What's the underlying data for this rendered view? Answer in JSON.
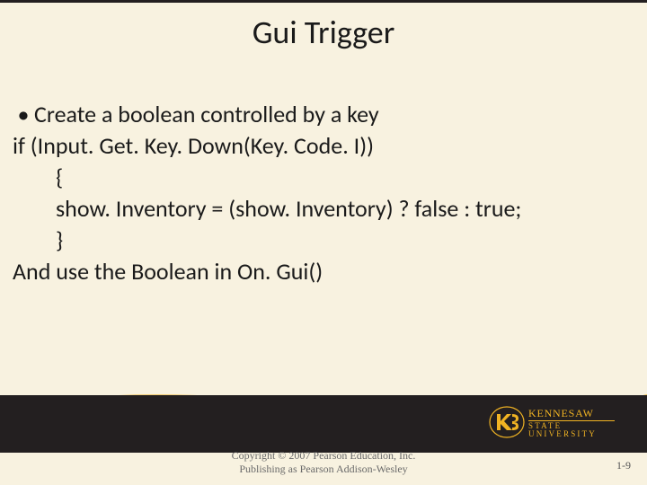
{
  "title": "Gui Trigger",
  "bullet": "Create a boolean controlled by a key",
  "lines": {
    "l1": "if (Input. Get. Key. Down(Key. Code. I))",
    "l2": "{",
    "l3": "show. Inventory = (show. Inventory) ? false : true;",
    "l4": "}",
    "l5": "And use the Boolean in On. Gui()"
  },
  "copyright": {
    "line1": "Copyright © 2007 Pearson Education, Inc.",
    "line2": "Publishing as Pearson Addison-Wesley"
  },
  "page_number": "1-9",
  "logo": {
    "name": "KENNESAW",
    "sub": "STATE UNIVERSITY"
  },
  "colors": {
    "bg": "#f8f2e0",
    "black": "#231f20",
    "gold": "#f0b323"
  }
}
